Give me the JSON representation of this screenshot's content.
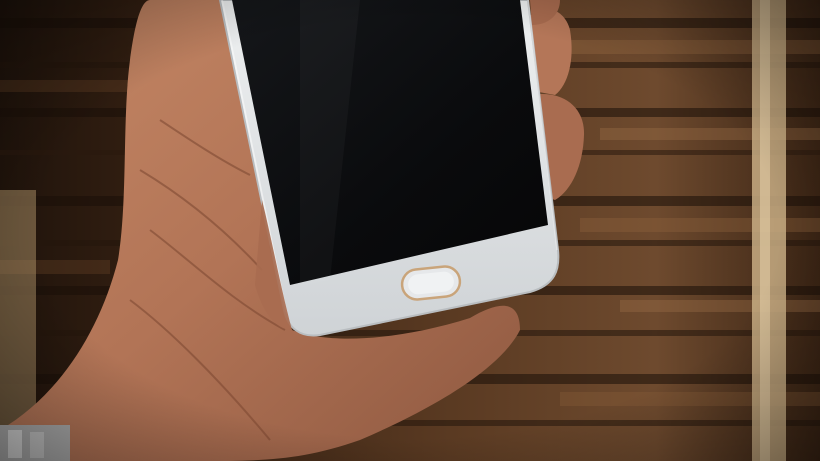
{
  "scene": {
    "subject": "hand-holding-smartphone",
    "colors": {
      "wood_dark": "#2b1a10",
      "wood_mid": "#5a3a24",
      "wood_light": "#8a6040",
      "skin": "#b77a5c",
      "skin_shadow": "#8a5540",
      "phone_frame": "#dcdfe0",
      "phone_screen": "#0b0c0e",
      "home_button_rim": "#c9a47a"
    }
  }
}
